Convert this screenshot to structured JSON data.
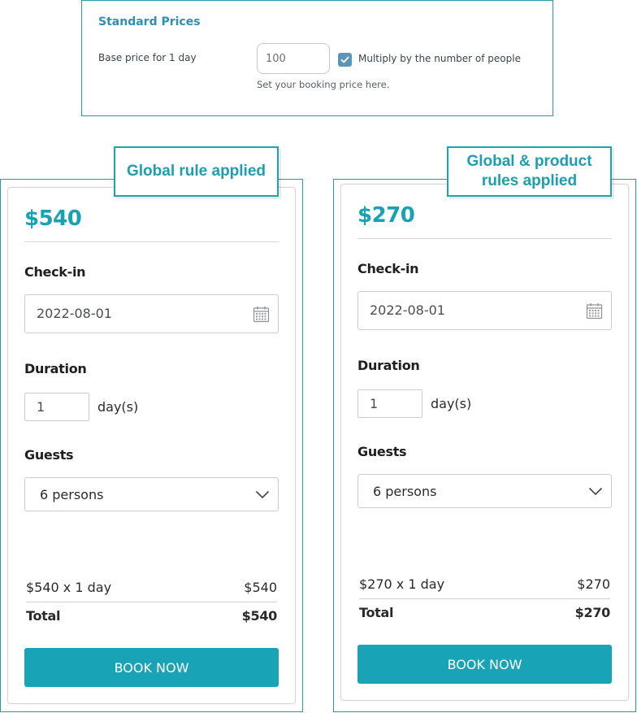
{
  "settings": {
    "title": "Standard Prices",
    "base_label": "Base price for 1 day",
    "base_value": "100",
    "multiply_label": "Multiply by the number of people",
    "multiply_checked": true,
    "help": "Set your booking price here."
  },
  "left": {
    "tag": "Global rule applied",
    "price": "$540",
    "checkin_label": "Check-in",
    "checkin_value": "2022-08-01",
    "duration_label": "Duration",
    "duration_value": "1",
    "duration_unit": "day(s)",
    "guests_label": "Guests",
    "guests_value": "6 persons",
    "line_label": "$540 x 1 day",
    "line_value": "$540",
    "total_label": "Total",
    "total_value": "$540",
    "book": "BOOK NOW"
  },
  "right": {
    "tag": "Global & product rules applied",
    "price": "$270",
    "checkin_label": "Check-in",
    "checkin_value": "2022-08-01",
    "duration_label": "Duration",
    "duration_value": "1",
    "duration_unit": "day(s)",
    "guests_label": "Guests",
    "guests_value": "6 persons",
    "line_label": "$270 x 1 day",
    "line_value": "$270",
    "total_label": "Total",
    "total_value": "$270",
    "book": "BOOK NOW"
  },
  "icons": {
    "checkbox": "check-icon",
    "calendar": "calendar-icon",
    "dropdown": "chevron-down-icon"
  },
  "colors": {
    "accent": "#19a3b6",
    "panel_border": "#2a9aa8",
    "settings_title": "#2f8fb0",
    "checkbox": "#5d95b8"
  }
}
